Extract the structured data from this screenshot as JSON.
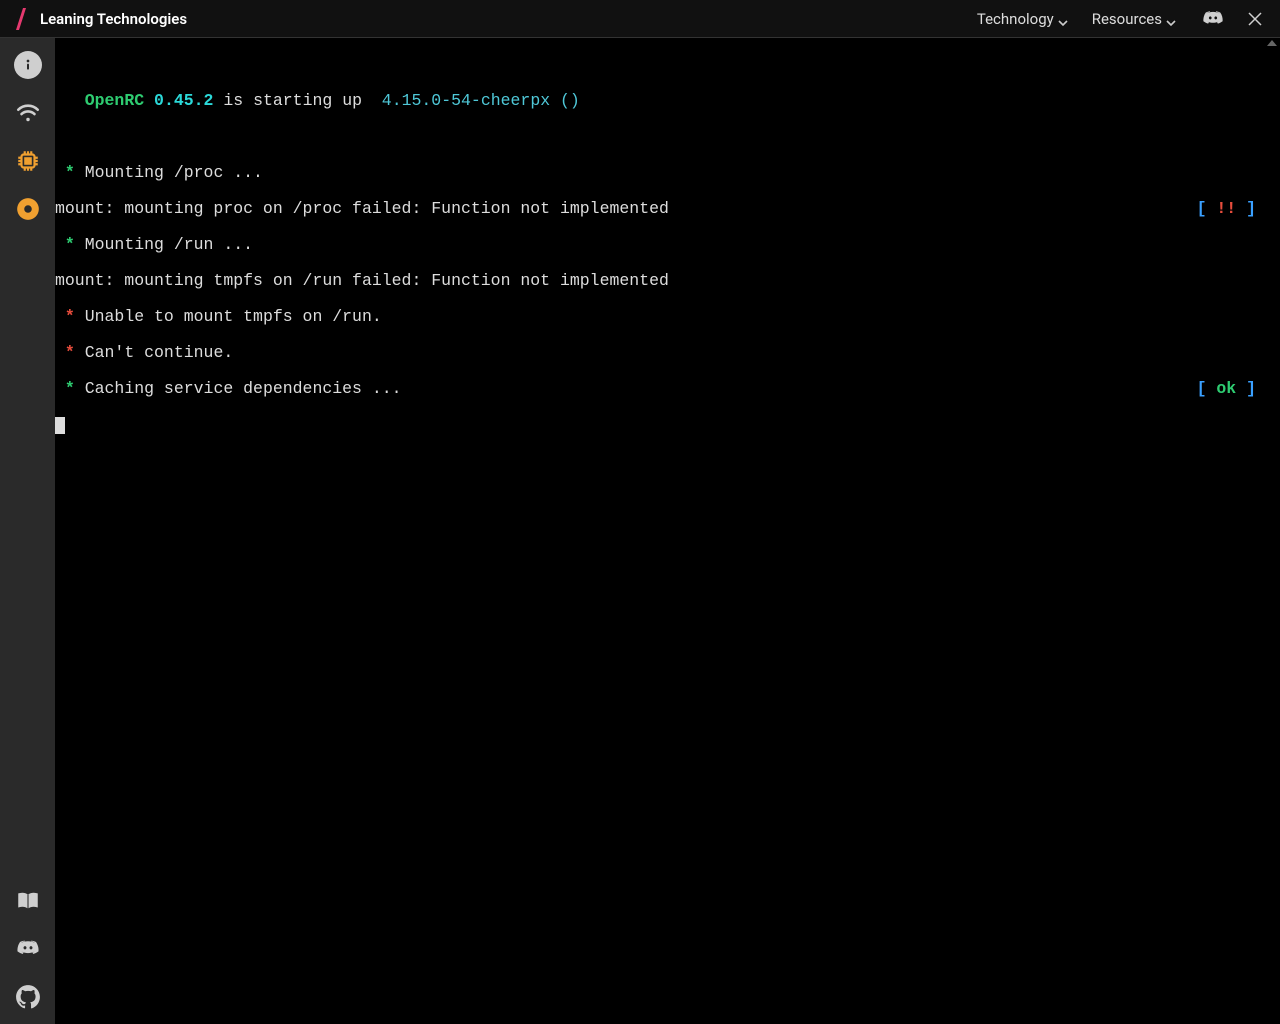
{
  "colors": {
    "accent_pink": "#e6396f",
    "orange": "#f0a030",
    "grey_icon": "#cfcfcf",
    "term_green": "#2ecc71",
    "term_cyan": "#2bd9d9",
    "term_blue": "#3aa0ff",
    "term_red": "#e74c3c"
  },
  "header": {
    "brand": "Leaning Technologies",
    "nav": [
      {
        "label": "Technology"
      },
      {
        "label": "Resources"
      }
    ],
    "icons": {
      "discord": "discord-icon",
      "x": "x-icon"
    }
  },
  "sidebar": {
    "top": [
      {
        "name": "info-icon"
      },
      {
        "name": "wifi-icon"
      },
      {
        "name": "cpu-icon"
      },
      {
        "name": "disc-icon"
      }
    ],
    "bottom": [
      {
        "name": "book-icon"
      },
      {
        "name": "discord-icon"
      },
      {
        "name": "github-icon"
      }
    ]
  },
  "terminal": {
    "indent": "   ",
    "line0": {
      "openrc": "OpenRC",
      "space1": " ",
      "version": "0.45.2",
      "mid": " is starting up  ",
      "kernel": "4.15.0-54-cheerpx ()"
    },
    "lines": [
      {
        "bullet": " * ",
        "bullet_color": "green",
        "text": "Mounting /proc ..."
      },
      {
        "text": "mount: mounting proc on /proc failed: Function not implemented",
        "status": {
          "open": "[ ",
          "val": "!!",
          "close": " ]",
          "val_color": "red"
        }
      },
      {
        "bullet": " * ",
        "bullet_color": "green",
        "text": "Mounting /run ..."
      },
      {
        "text": "mount: mounting tmpfs on /run failed: Function not implemented"
      },
      {
        "bullet": " * ",
        "bullet_color": "red",
        "text": "Unable to mount tmpfs on /run."
      },
      {
        "bullet": " * ",
        "bullet_color": "red",
        "text": "Can't continue."
      },
      {
        "bullet": " * ",
        "bullet_color": "green",
        "text": "Caching service dependencies ...",
        "status": {
          "open": "[ ",
          "val": "ok",
          "close": " ]",
          "val_color": "green"
        }
      }
    ]
  }
}
